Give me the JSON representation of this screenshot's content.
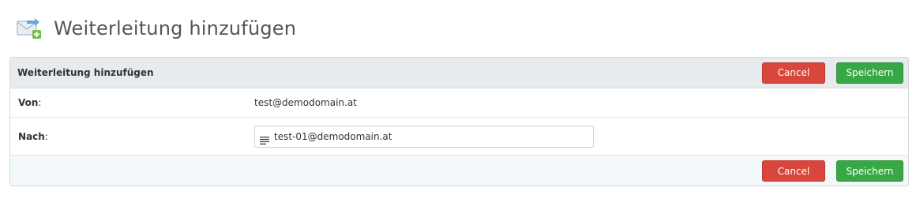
{
  "header": {
    "title": "Weiterleitung hinzufügen",
    "icon": "mail-forward-add-icon"
  },
  "panel": {
    "title": "Weiterleitung hinzufügen",
    "cancel_label": "Cancel",
    "save_label": "Speichern"
  },
  "form": {
    "from_label": "Von",
    "from_value": "test@demodomain.at",
    "to_label": "Nach",
    "to_value": "test-01@demodomain.at",
    "to_icon": "list-icon"
  },
  "footer": {
    "cancel_label": "Cancel",
    "save_label": "Speichern"
  },
  "colors": {
    "cancel": "#d9463b",
    "save": "#37a845",
    "panel_header_bg": "#e8ebee",
    "panel_footer_bg": "#f3f8fa"
  }
}
